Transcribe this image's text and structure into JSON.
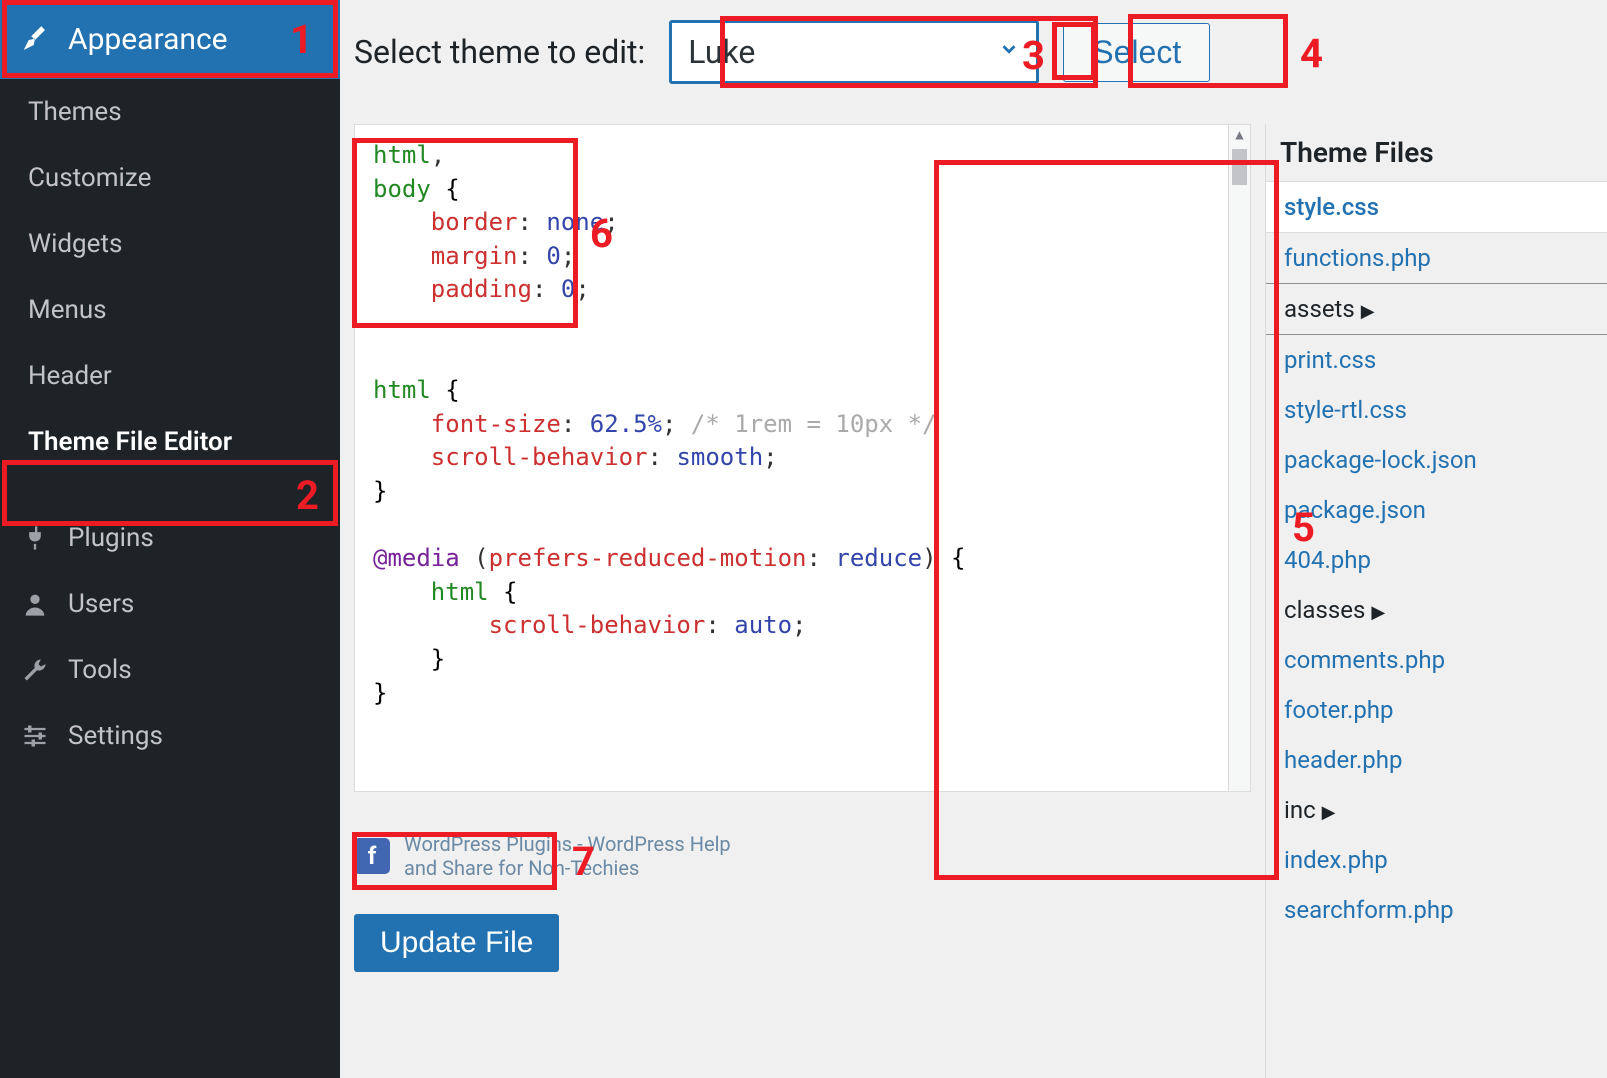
{
  "sidebar": {
    "top": {
      "label": "Appearance"
    },
    "submenu": [
      {
        "label": "Themes"
      },
      {
        "label": "Customize"
      },
      {
        "label": "Widgets"
      },
      {
        "label": "Menus"
      },
      {
        "label": "Header"
      },
      {
        "label": "Theme File Editor",
        "active": true
      }
    ],
    "menu": [
      {
        "label": "Plugins",
        "icon": "plug"
      },
      {
        "label": "Users",
        "icon": "user"
      },
      {
        "label": "Tools",
        "icon": "wrench"
      },
      {
        "label": "Settings",
        "icon": "sliders"
      }
    ]
  },
  "topbar": {
    "label": "Select theme to edit:",
    "selected": "Luke",
    "select_btn": "Select"
  },
  "editor": {
    "code_tokens": [
      {
        "t": "tag",
        "v": "html"
      },
      {
        "t": "plain",
        "v": ",\n"
      },
      {
        "t": "tag",
        "v": "body"
      },
      {
        "t": "plain",
        "v": " "
      },
      {
        "t": "brace",
        "v": "{"
      },
      {
        "t": "plain",
        "v": "\n    "
      },
      {
        "t": "prop",
        "v": "border"
      },
      {
        "t": "plain",
        "v": ": "
      },
      {
        "t": "val",
        "v": "none"
      },
      {
        "t": "plain",
        "v": ";\n    "
      },
      {
        "t": "prop",
        "v": "margin"
      },
      {
        "t": "plain",
        "v": ": "
      },
      {
        "t": "val",
        "v": "0"
      },
      {
        "t": "plain",
        "v": ";\n    "
      },
      {
        "t": "prop",
        "v": "padding"
      },
      {
        "t": "plain",
        "v": ": "
      },
      {
        "t": "val",
        "v": "0"
      },
      {
        "t": "plain",
        "v": ";\n\n\n"
      },
      {
        "t": "tag",
        "v": "html"
      },
      {
        "t": "plain",
        "v": " "
      },
      {
        "t": "brace",
        "v": "{"
      },
      {
        "t": "plain",
        "v": "\n    "
      },
      {
        "t": "prop",
        "v": "font-size"
      },
      {
        "t": "plain",
        "v": ": "
      },
      {
        "t": "val",
        "v": "62.5%"
      },
      {
        "t": "plain",
        "v": "; "
      },
      {
        "t": "cmt",
        "v": "/* 1rem = 10px */"
      },
      {
        "t": "plain",
        "v": "\n    "
      },
      {
        "t": "prop",
        "v": "scroll-behavior"
      },
      {
        "t": "plain",
        "v": ": "
      },
      {
        "t": "val",
        "v": "smooth"
      },
      {
        "t": "plain",
        "v": ";\n"
      },
      {
        "t": "brace",
        "v": "}"
      },
      {
        "t": "plain",
        "v": "\n\n"
      },
      {
        "t": "at",
        "v": "@media"
      },
      {
        "t": "plain",
        "v": " ("
      },
      {
        "t": "prop",
        "v": "prefers-reduced-motion"
      },
      {
        "t": "plain",
        "v": ": "
      },
      {
        "t": "val",
        "v": "reduce"
      },
      {
        "t": "plain",
        "v": ") "
      },
      {
        "t": "brace",
        "v": "{"
      },
      {
        "t": "plain",
        "v": "\n    "
      },
      {
        "t": "tag",
        "v": "html"
      },
      {
        "t": "plain",
        "v": " "
      },
      {
        "t": "brace",
        "v": "{"
      },
      {
        "t": "plain",
        "v": "\n        "
      },
      {
        "t": "prop",
        "v": "scroll-behavior"
      },
      {
        "t": "plain",
        "v": ": "
      },
      {
        "t": "val",
        "v": "auto"
      },
      {
        "t": "plain",
        "v": ";\n    "
      },
      {
        "t": "brace",
        "v": "}"
      },
      {
        "t": "plain",
        "v": "\n"
      },
      {
        "t": "brace",
        "v": "}"
      }
    ],
    "promo_line1": "WordPress Plugins - WordPress Help",
    "promo_line2": "and Share for Non-Techies",
    "update_btn": "Update File"
  },
  "files": {
    "title": "Theme Files",
    "items": [
      {
        "label": "style.css",
        "kind": "file",
        "current": true
      },
      {
        "label": "functions.php",
        "kind": "file"
      },
      {
        "label": "assets",
        "kind": "folder",
        "bordered": true
      },
      {
        "label": "print.css",
        "kind": "file"
      },
      {
        "label": "style-rtl.css",
        "kind": "file"
      },
      {
        "label": "package-lock.json",
        "kind": "file"
      },
      {
        "label": "package.json",
        "kind": "file"
      },
      {
        "label": "404.php",
        "kind": "file"
      },
      {
        "label": "classes",
        "kind": "folder"
      },
      {
        "label": "comments.php",
        "kind": "file"
      },
      {
        "label": "footer.php",
        "kind": "file"
      },
      {
        "label": "header.php",
        "kind": "file"
      },
      {
        "label": "inc",
        "kind": "folder"
      },
      {
        "label": "index.php",
        "kind": "file"
      },
      {
        "label": "searchform.php",
        "kind": "file"
      }
    ]
  },
  "annotations": {
    "n1": "1",
    "n2": "2",
    "n3": "3",
    "n4": "4",
    "n5": "5",
    "n6": "6",
    "n7": "7"
  }
}
